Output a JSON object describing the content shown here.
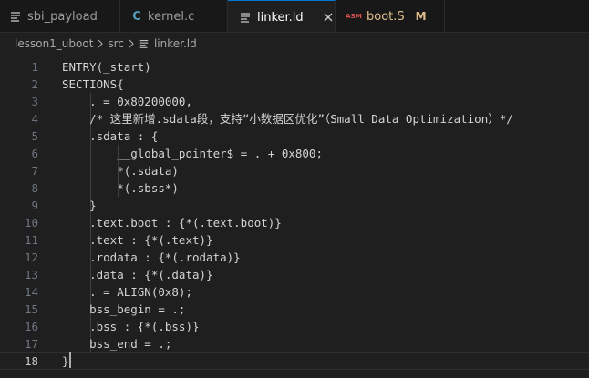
{
  "tabs": [
    {
      "label": "sbi_payload",
      "icon": "file-lines-icon",
      "active": false
    },
    {
      "label": "kernel.c",
      "icon": "c-language-icon",
      "icon_text": "C",
      "active": false
    },
    {
      "label": "linker.ld",
      "icon": "file-lines-icon",
      "active": true
    },
    {
      "label": "boot.S",
      "icon": "asm-icon",
      "icon_text": "ASM",
      "active": false,
      "badge": "M"
    }
  ],
  "breadcrumb": {
    "parts": [
      "lesson1_uboot",
      "src"
    ],
    "file": "linker.ld"
  },
  "editor": {
    "current_line": 18,
    "lines": [
      {
        "n": "1",
        "text": "ENTRY(_start)"
      },
      {
        "n": "2",
        "text": "SECTIONS{"
      },
      {
        "n": "3",
        "text": "    . = 0x80200000,"
      },
      {
        "n": "4",
        "text": "    /* 这里新增.sdata段，支持“小数据区优化”（Small Data Optimization）*/"
      },
      {
        "n": "5",
        "text": "    .sdata : {"
      },
      {
        "n": "6",
        "text": "        __global_pointer$ = . + 0x800;"
      },
      {
        "n": "7",
        "text": "        *(.sdata)"
      },
      {
        "n": "8",
        "text": "        *(.sbss*)"
      },
      {
        "n": "9",
        "text": "    }"
      },
      {
        "n": "10",
        "text": "    .text.boot : {*(.text.boot)}"
      },
      {
        "n": "11",
        "text": "    .text : {*(.text)}"
      },
      {
        "n": "12",
        "text": "    .rodata : {*(.rodata)}"
      },
      {
        "n": "13",
        "text": "    .data : {*(.data)}"
      },
      {
        "n": "14",
        "text": "    . = ALIGN(0x8);"
      },
      {
        "n": "15",
        "text": "    bss_begin = .;"
      },
      {
        "n": "16",
        "text": "    .bss : {*(.bss)}"
      },
      {
        "n": "17",
        "text": "    bss_end = .;"
      },
      {
        "n": "18",
        "text": "}"
      }
    ]
  },
  "colors": {
    "active_tab_border": "#0078d4",
    "modified": "#e2c08d",
    "asm_icon": "#e05252",
    "c_icon": "#519aba"
  }
}
